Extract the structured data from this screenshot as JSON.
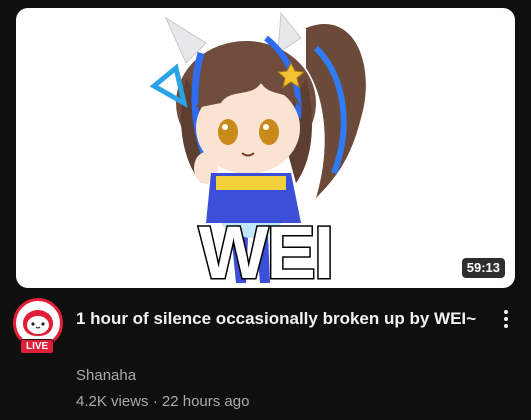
{
  "video": {
    "thumbnail_caption": "WEI",
    "duration": "59:13",
    "title": "1 hour of silence occasionally broken up by WEI~",
    "channel": "Shanaha",
    "views": "4.2K views",
    "separator": "·",
    "age": "22 hours ago"
  },
  "avatar": {
    "live_label": "LIVE",
    "ring_color": "#e01e37"
  },
  "icons": {
    "menu": "more-vertical-icon"
  },
  "colors": {
    "background": "#0f0f0f",
    "title": "#f1f1f1",
    "secondary_text": "#aaaaaa",
    "live_red": "#e01e37"
  }
}
